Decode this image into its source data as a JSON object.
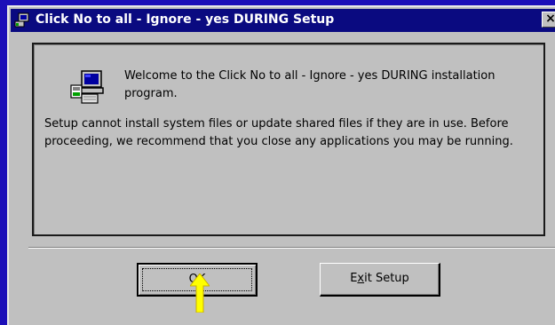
{
  "window": {
    "title": "Click No to all - Ignore - yes DURING Setup",
    "close_label": "×"
  },
  "dialog": {
    "welcome": "Welcome to the Click No to all - Ignore - yes DURING installation program.",
    "notice": "Setup cannot install system files or update shared files if they are in use. Before proceeding, we recommend that you close any applications you may be running."
  },
  "buttons": {
    "ok_label": "OK",
    "exit_before": "E",
    "exit_mnemonic": "x",
    "exit_after": "it Setup"
  },
  "icons": {
    "title": "setup-computer-icon",
    "dialog": "setup-computer-icon",
    "pointer": "yellow-arrow-icon"
  },
  "colors": {
    "desktop": "#1c0fb8",
    "titlebar": "#0a0a80",
    "face": "#c0c0c0",
    "pointer": "#ffff00"
  }
}
